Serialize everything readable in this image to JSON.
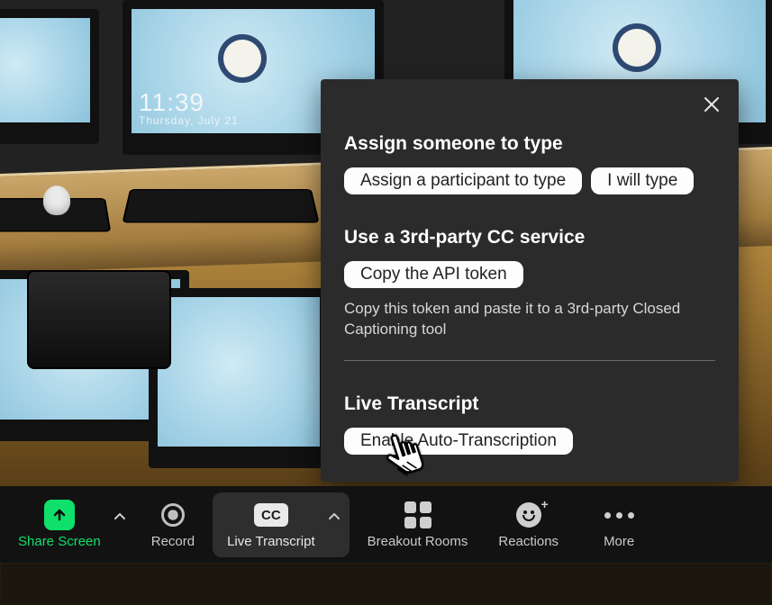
{
  "background": {
    "clock_time": "11:39",
    "clock_date": "Thursday, July 21"
  },
  "panel": {
    "section1_title": "Assign someone to type",
    "assign_btn": "Assign a participant to type",
    "self_btn": "I will type",
    "section2_title": "Use a 3rd-party CC service",
    "copy_btn": "Copy the API token",
    "copy_help": "Copy this token and paste it to a 3rd-party Closed Captioning tool",
    "section3_title": "Live Transcript",
    "enable_btn": "Enable Auto-Transcription"
  },
  "toolbar": {
    "share": "Share Screen",
    "record": "Record",
    "transcript": "Live Transcript",
    "cc_badge": "CC",
    "rooms": "Breakout Rooms",
    "reactions": "Reactions",
    "more": "More"
  }
}
